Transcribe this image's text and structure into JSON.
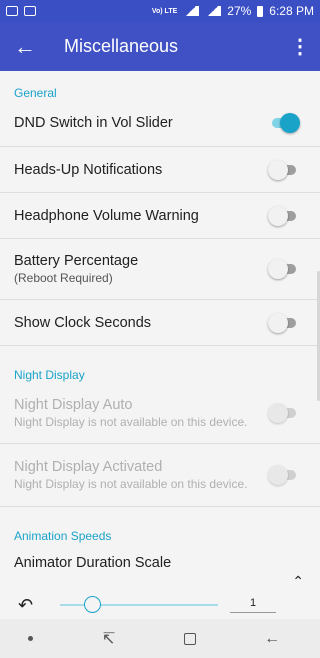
{
  "status_bar": {
    "lte_label": "Vo) LTE",
    "battery_text": "27%",
    "time": "6:28 PM"
  },
  "app_bar": {
    "back_icon": "arrow-back-icon",
    "title": "Miscellaneous",
    "menu_icon": "more-vert-icon"
  },
  "sections": {
    "general": {
      "header": "General",
      "items": [
        {
          "label": "DND Switch in Vol Slider",
          "toggle": "on"
        },
        {
          "label": "Heads-Up Notifications",
          "toggle": "off"
        },
        {
          "label": "Headphone Volume Warning",
          "toggle": "off"
        },
        {
          "label": "Battery Percentage",
          "sub": "(Reboot Required)",
          "toggle": "off"
        },
        {
          "label": "Show Clock Seconds",
          "toggle": "off"
        }
      ]
    },
    "night_display": {
      "header": "Night Display",
      "items": [
        {
          "label": "Night Display Auto",
          "sub": "Night Display is not available on this device.",
          "toggle": "disabled"
        },
        {
          "label": "Night Display Activated",
          "sub": "Night Display is not available on this device.",
          "toggle": "disabled"
        }
      ]
    },
    "animation": {
      "header": "Animation Speeds",
      "item_label": "Animator Duration Scale",
      "slider_value": "1",
      "slider_fraction": 0.2
    }
  },
  "colors": {
    "app_bar": "#3f51c5",
    "status_bar": "#3b4fc4",
    "accent": "#1aa3c9"
  },
  "nav_bar": {
    "icons": [
      "nav-dot-icon",
      "recent-apps-icon",
      "home-icon",
      "back-icon"
    ]
  }
}
